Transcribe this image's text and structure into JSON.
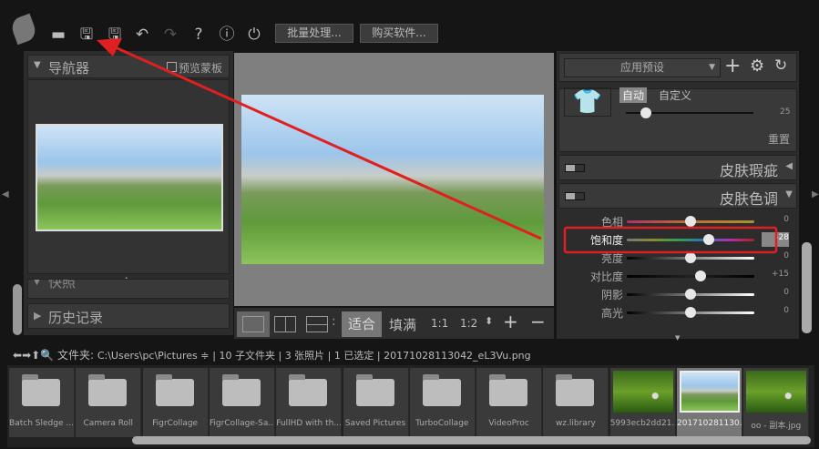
{
  "toolbar": {
    "batch_label": "批量处理...",
    "buy_label": "购买软件..."
  },
  "navigator": {
    "title": "导航器",
    "preview_mask": "预览蒙板",
    "snapshot": "快照",
    "history": "历史记录"
  },
  "view": {
    "sep": ":",
    "fit": "适合",
    "fill": "填满",
    "ratio1": "1:1",
    "ratio2": "1:2"
  },
  "right": {
    "preset": "应用预设",
    "auto": "自动",
    "custom": "自定义",
    "top_value": "25",
    "reset": "重置",
    "section1": "皮肤瑕疵",
    "section2": "皮肤色调",
    "sliders": [
      {
        "label": "色相",
        "value": "0",
        "pos": 0.5
      },
      {
        "label": "饱和度",
        "value": "-28",
        "pos": 0.64
      },
      {
        "label": "亮度",
        "value": "0",
        "pos": 0.5
      },
      {
        "label": "对比度",
        "value": "+15",
        "pos": 0.575
      },
      {
        "label": "阴影",
        "value": "0",
        "pos": 0.5
      },
      {
        "label": "高光",
        "value": "0",
        "pos": 0.5
      }
    ]
  },
  "path": {
    "folder_label": "文件夹:",
    "path": "C:\\Users\\pc\\Pictures ≑",
    "info": "| 10 子文件夹 | 3 张照片 | 1 已选定 | 20171028113042_eL3Vu.png"
  },
  "files": [
    {
      "name": "Batch Sledge ...",
      "type": "folder"
    },
    {
      "name": "Camera Roll",
      "type": "folder"
    },
    {
      "name": "FigrCollage",
      "type": "folder"
    },
    {
      "name": "FigrCollage-Sa...",
      "type": "folder"
    },
    {
      "name": "FullHD with th...",
      "type": "folder"
    },
    {
      "name": "Saved Pictures",
      "type": "folder"
    },
    {
      "name": "TurboCollage",
      "type": "folder"
    },
    {
      "name": "VideoProc",
      "type": "folder"
    },
    {
      "name": "wz.library",
      "type": "folder"
    },
    {
      "name": "5993ecb2dd21...",
      "type": "image"
    },
    {
      "name": "201710281130...",
      "type": "image",
      "selected": true
    },
    {
      "name": "oo - 副本.jpg",
      "type": "image"
    }
  ],
  "colors": {
    "highlight": "#e02020"
  }
}
